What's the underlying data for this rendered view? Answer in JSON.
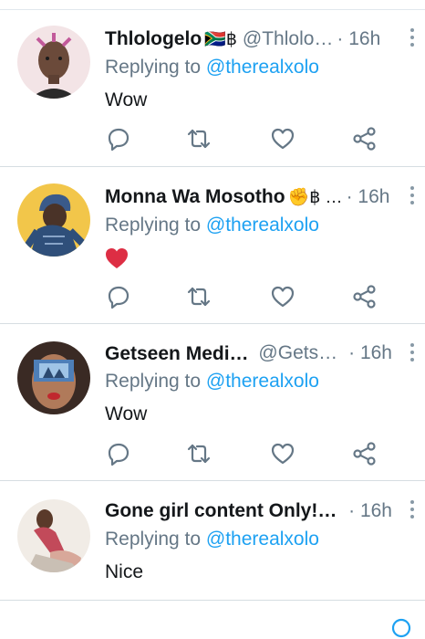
{
  "colors": {
    "accent": "#1da1f2",
    "secondary_text": "#657786",
    "primary_text": "#14171a",
    "heart_red": "#e0245e"
  },
  "replies": [
    {
      "display_name": "Thlologelo",
      "badge": "🇿🇦฿",
      "handle": "@Thlolo…",
      "time": "· 16h",
      "replying_prefix": "Replying to",
      "mention": "@therealxolo",
      "text": "Wow"
    },
    {
      "display_name": "Monna Wa Mosotho",
      "badge": "✊฿ …",
      "handle": "",
      "time": "· 16h",
      "replying_prefix": "Replying to",
      "mention": "@therealxolo",
      "text": "",
      "emoji": "red-heart-emoji"
    },
    {
      "display_name": "Getseen Media ฿",
      "badge": "",
      "handle": "@Getse…",
      "time": "· 16h",
      "replying_prefix": "Replying to",
      "mention": "@therealxolo",
      "text": "Wow"
    },
    {
      "display_name": "Gone girl content Only!! …",
      "badge": "",
      "handle": "",
      "time": "· 16h",
      "replying_prefix": "Replying to",
      "mention": "@therealxolo",
      "text": "Nice"
    }
  ],
  "icons": {
    "reply": "reply-icon",
    "retweet": "retweet-icon",
    "like": "like-icon",
    "share": "share-icon",
    "more": "more-vertical-icon"
  }
}
